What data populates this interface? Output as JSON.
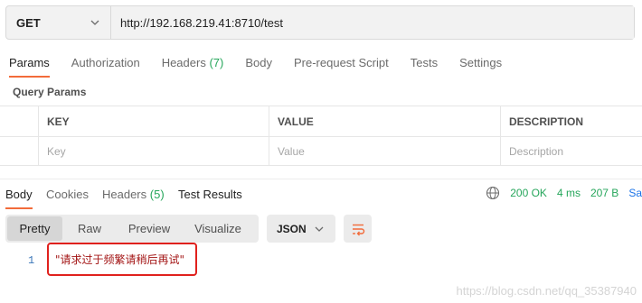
{
  "request": {
    "method": "GET",
    "url": "http://192.168.219.41:8710/test"
  },
  "request_tabs": [
    {
      "label": "Params",
      "count": ""
    },
    {
      "label": "Authorization",
      "count": ""
    },
    {
      "label": "Headers",
      "count": "(7)"
    },
    {
      "label": "Body",
      "count": ""
    },
    {
      "label": "Pre-request Script",
      "count": ""
    },
    {
      "label": "Tests",
      "count": ""
    },
    {
      "label": "Settings",
      "count": ""
    }
  ],
  "query_params": {
    "title": "Query Params",
    "columns": [
      "KEY",
      "VALUE",
      "DESCRIPTION"
    ],
    "placeholders": [
      "Key",
      "Value",
      "Description"
    ]
  },
  "response_tabs": [
    {
      "label": "Body",
      "count": ""
    },
    {
      "label": "Cookies",
      "count": ""
    },
    {
      "label": "Headers",
      "count": "(5)"
    },
    {
      "label": "Test Results",
      "count": ""
    }
  ],
  "status": {
    "code": "200 OK",
    "time": "4 ms",
    "size": "207 B",
    "save": "Sa"
  },
  "view_modes": [
    "Pretty",
    "Raw",
    "Preview",
    "Visualize"
  ],
  "format": "JSON",
  "response_body": {
    "line_number": "1",
    "text": "\"请求过于频繁请稍后再试\""
  },
  "watermark": "https://blog.csdn.net/qq_35387940",
  "colors": {
    "accent": "#f26b3a",
    "status_ok": "#26a65b",
    "highlight_border": "#e0211d",
    "string_text": "#a31515"
  },
  "icons": {
    "method_dropdown": "chevron-down-icon",
    "network": "globe-icon",
    "format_dropdown": "chevron-down-icon",
    "wrap": "wrap-lines-icon"
  }
}
